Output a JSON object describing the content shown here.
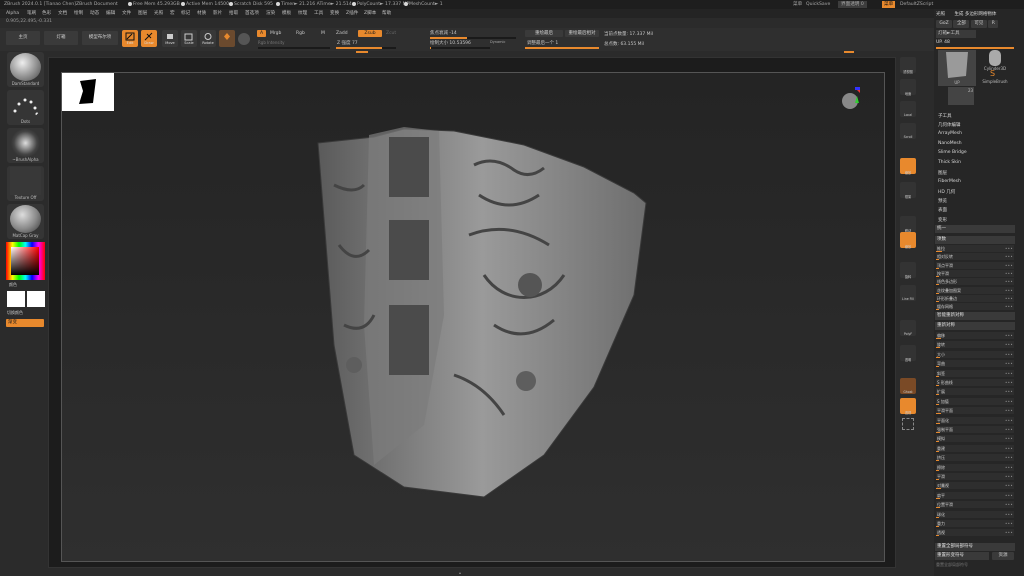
{
  "titlebar": {
    "app": "ZBrush 2024.0.1 [Tianao Chen]",
    "doc": "ZBrush Document",
    "free_mem": "Free Mem 45.293GB",
    "active_mem": "Active Mem 14500",
    "scratch": "Scratch Disk 595",
    "timer": "Timer► 21.216 ATime► 21.514",
    "polycount": "PolyCount► 17.337 MP",
    "meshcount": "MeshCount► 1",
    "right": [
      "菜单",
      "QuickSave",
      "界面透明 0",
      "菜单",
      "DefaultZScript"
    ]
  },
  "menu": {
    "items": [
      "Alpha",
      "笔刷",
      "色彩",
      "文档",
      "绘制",
      "动态",
      "编辑",
      "文件",
      "图层",
      "光照",
      "宏",
      "标记",
      "材质",
      "影片",
      "拾取",
      "首选项",
      "渲染",
      "模板",
      "纹理",
      "工具",
      "变换",
      "Z插件",
      "Z脚本",
      "帮助"
    ],
    "coords": "0.905,22.495,-0.331"
  },
  "shelf": {
    "home": "主页",
    "lightbox": "灯箱",
    "timeline": "模型布尔项",
    "tools": [
      {
        "label": "Edit",
        "icon": "edit-icon",
        "on": true
      },
      {
        "label": "Draw",
        "icon": "draw-icon",
        "on": true
      },
      {
        "label": "Move",
        "icon": "move-icon",
        "on": false
      },
      {
        "label": "Scale",
        "icon": "scale-icon",
        "on": false
      },
      {
        "label": "Rotate",
        "icon": "rotate-icon",
        "on": false
      }
    ],
    "a_label": "A",
    "mrgb": "Mrgb",
    "rgb": "Rgb",
    "m": "M",
    "zadd": "Zadd",
    "zsub": "Zsub",
    "zcut": "Zcut",
    "rgb_intensity": "Rgb Intensity",
    "z_intensity": "Z 强度 77",
    "focal_shift": "焦点衰减 -14",
    "draw_size": "绘制大小 10.53596",
    "dynamic": "Dynamic",
    "redraw_last": "重绘最后",
    "redraw_last_rel": "重绘最后相对",
    "adjust_last": "调整最后一个 1",
    "active_points": "当前点数量: 17.337 Mil",
    "total_points": "总点数: 63.155 Mil"
  },
  "left": {
    "materials": [
      "DamStandard",
      "Dots",
      "~BrushAlpha",
      "Texture Off",
      "MatCap Gray"
    ],
    "color_label": "颜色",
    "switch_color": "切换颜色",
    "gradient": "渐变"
  },
  "right_tools": [
    "透视图",
    "地面",
    "Local",
    "Scroll",
    "缩放",
    "框架",
    "移动",
    "缩放",
    "旋转",
    "Line Fill",
    "PolyF",
    "透明",
    "Ghost",
    "透视"
  ],
  "right_panel": {
    "header": [
      "光照",
      "生成 多边形网格物体"
    ],
    "tabs": [
      "GoZ",
      "全部",
      "可见",
      "R"
    ],
    "lightbox_tools": "灯箱►工具",
    "up": "UP. 48",
    "thumbs": [
      "UP",
      "Cylinder3D",
      "SimpleBrush",
      "23"
    ],
    "menu_items": [
      "子工具",
      "几何体编辑",
      "ArrayMesh",
      "NanoMesh",
      "Slime Bridge",
      "Thick Skin",
      "图层",
      "FiberMesh",
      "HD 几何",
      "预览",
      "表面",
      "变形"
    ],
    "sections": [
      "统一",
      "项数",
      "智能重新对称",
      "重新对称",
      "重置全部局部符号",
      "重置形变符号"
    ],
    "rows_a": [
      "推拉",
      "相对反转",
      "顶点平滑",
      "按平滑",
      "线色多边形",
      "花纹叠加图案",
      "环形折叠边",
      "缓存网格"
    ],
    "rows_b": [
      "偏移",
      "旋转",
      "大小",
      "弯曲",
      "斜签",
      "S 形曲线",
      "扩展",
      "S 加值",
      "平滑平面",
      "平面化",
      "强制平面",
      "模拟",
      "重建",
      "挤压",
      "擦除",
      "平滑",
      "对凲视",
      "扁平",
      "位置平滑",
      "球化",
      "重力",
      "透视"
    ],
    "bottom_btns": [
      "应用",
      "资源"
    ],
    "restore": "重置全部局部符号"
  },
  "bottom": "▴"
}
